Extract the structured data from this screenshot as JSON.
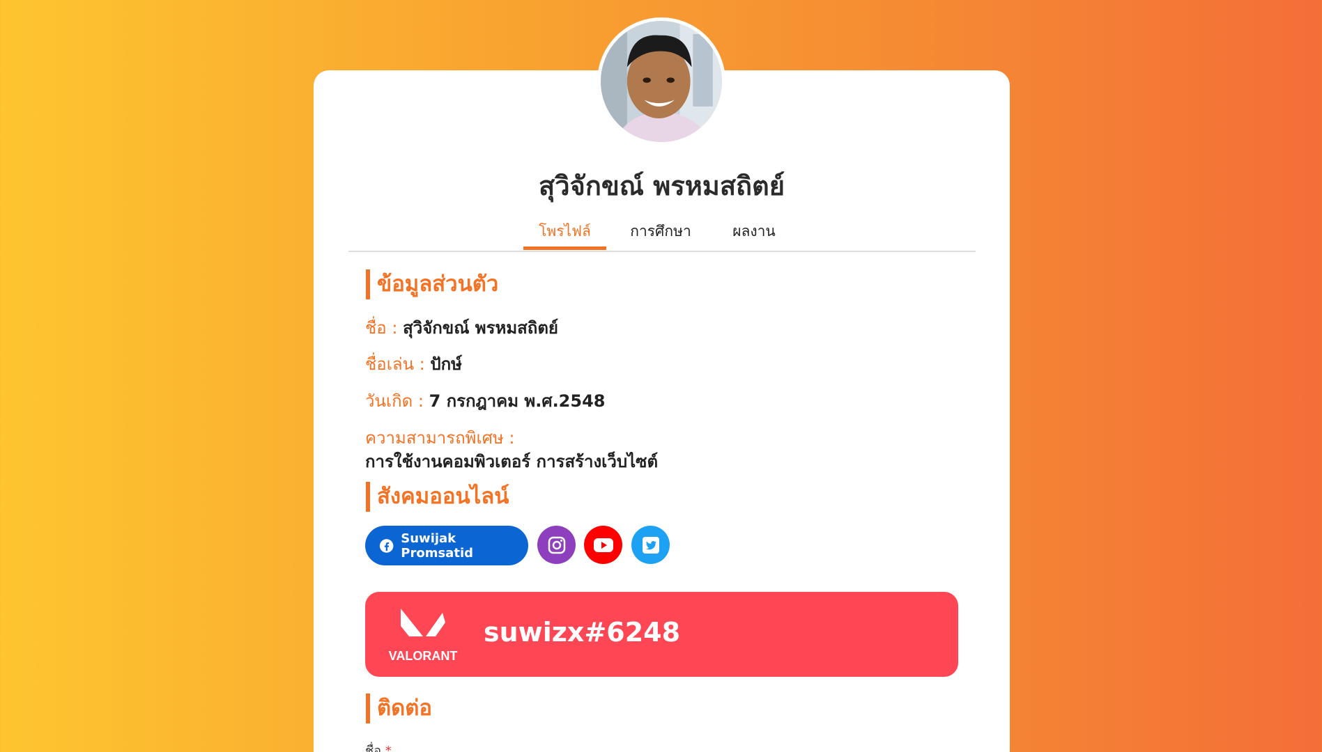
{
  "profile": {
    "full_name": "สุวิจักขณ์ พรหมสถิตย์"
  },
  "tabs": [
    {
      "label": "โพรไฟล์",
      "active": true
    },
    {
      "label": "การศึกษา",
      "active": false
    },
    {
      "label": "ผลงาน",
      "active": false
    }
  ],
  "personal": {
    "heading": "ข้อมูลส่วนตัว",
    "name_label": "ชื่อ :",
    "name_value": "สุวิจักขณ์ พรหมสถิตย์",
    "nickname_label": "ชื่อเล่น :",
    "nickname_value": "ปักษ์",
    "birthday_label": "วันเกิด :",
    "birthday_value": "7 กรกฎาคม พ.ศ.2548",
    "skills_label": "ความสามารถพิเศษ :",
    "skills_value": "การใช้งานคอมพิวเตอร์ การสร้างเว็บไซต์"
  },
  "social": {
    "heading": "สังคมออนไลน์",
    "facebook_label": "Suwijak Promsatid",
    "colors": {
      "facebook": "#0b66d3",
      "instagram": "#8e3fbe",
      "youtube": "#ff0000",
      "twitter": "#1da1f2"
    }
  },
  "valorant": {
    "brand": "VALORANT",
    "riot_id": "suwizx#6248",
    "color": "#ff4655"
  },
  "contact": {
    "heading": "ติดต่อ",
    "name_label": "ชื่อ",
    "required_mark": "*"
  },
  "theme": {
    "accent": "#f47224"
  }
}
